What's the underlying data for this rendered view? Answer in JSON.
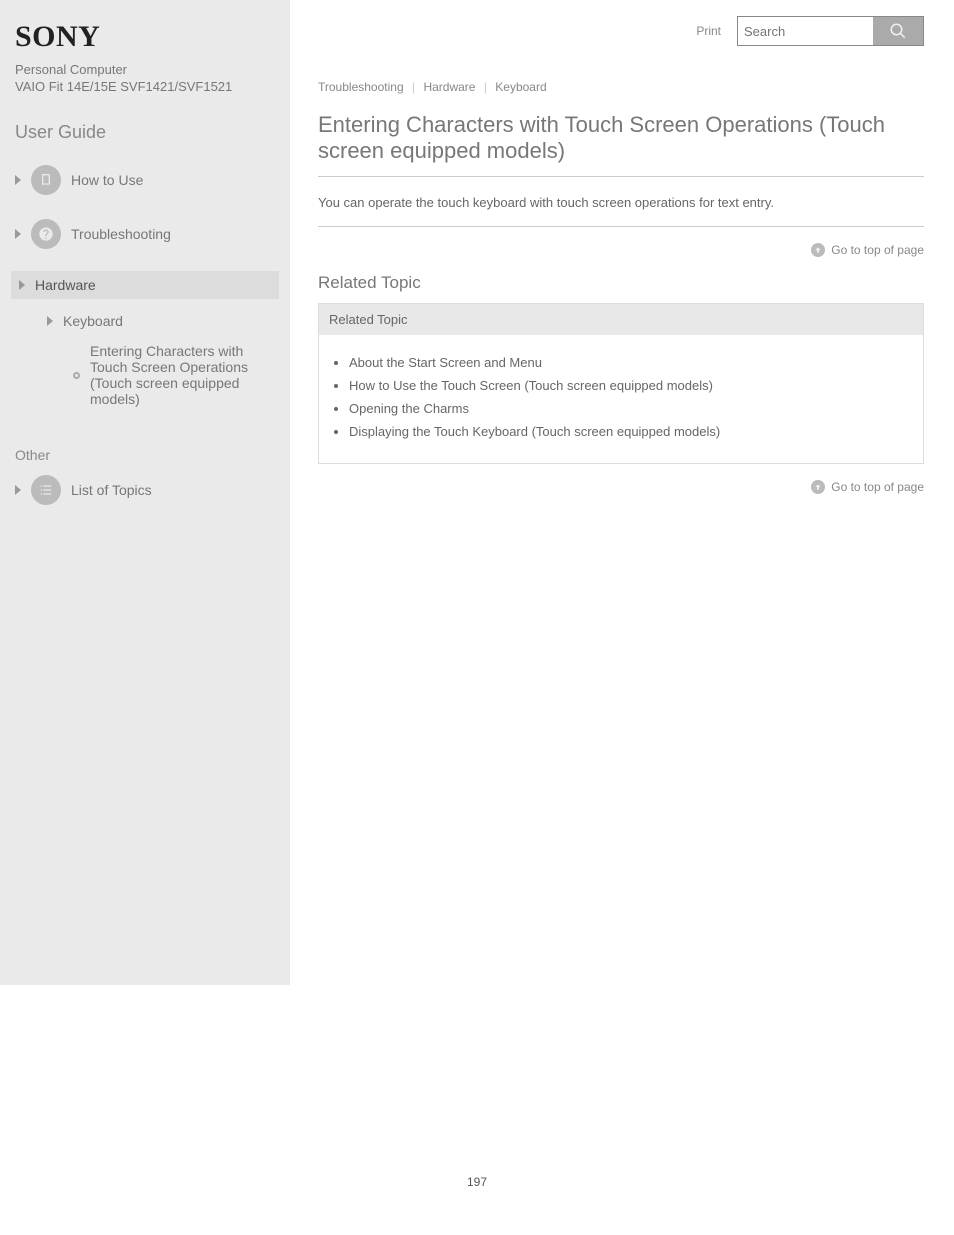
{
  "brand": "SONY",
  "product_name": "Personal Computer",
  "product_model": "VAIO Fit 14E/15E  SVF1421/SVF1521",
  "user_guide_label": "User Guide",
  "nav": {
    "how_to_use": "How to Use",
    "troubleshooting": "Troubleshooting",
    "hardware": "Hardware",
    "keyboard": "Keyboard",
    "keyboard_desc": "Entering Characters with Touch Screen Operations\n(Touch screen equipped models)"
  },
  "other_heading": "Other",
  "list_of_topics": "List of Topics",
  "top": {
    "print_label": "Print",
    "search_placeholder": "Search"
  },
  "breadcrumb": {
    "a": "Troubleshooting",
    "b": "Hardware",
    "c": "Keyboard"
  },
  "article": {
    "title": "Entering Characters with Touch Screen Operations (Touch screen equipped models)",
    "body": "You can operate the touch keyboard with touch screen operations for text entry.",
    "goto_top": "Go to top of page"
  },
  "section_title": "Related Topic",
  "related": {
    "header": "Related Topic",
    "items": [
      "About the Start Screen and Menu",
      "How to Use the Touch Screen (Touch screen equipped models)",
      "Opening the Charms",
      "Displaying the Touch Keyboard (Touch screen equipped models)"
    ]
  },
  "page_number": "197"
}
